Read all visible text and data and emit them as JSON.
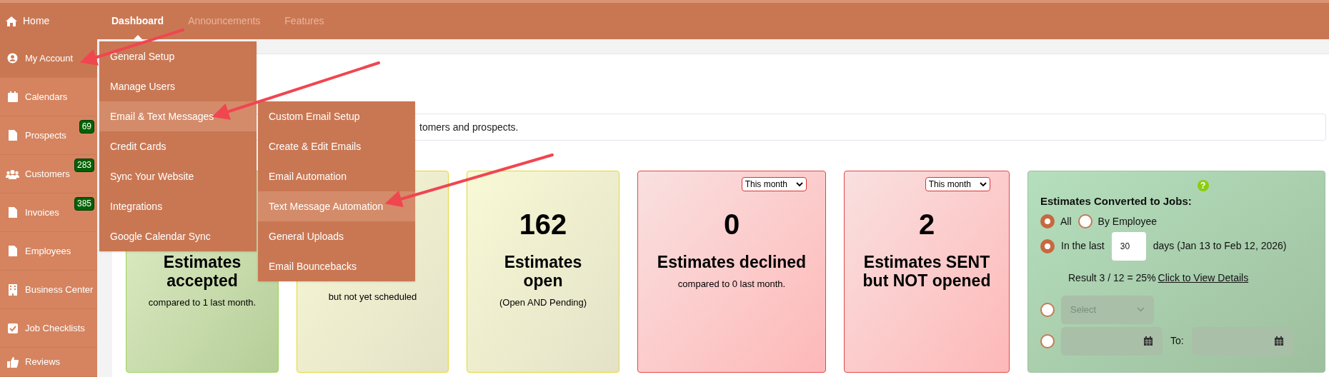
{
  "home_link": {
    "label": "Home"
  },
  "tabs": [
    {
      "label": "Dashboard",
      "selected": true
    },
    {
      "label": "Announcements",
      "selected": false
    },
    {
      "label": "Features",
      "selected": false
    }
  ],
  "sidebar": {
    "items": [
      {
        "label": "My Account",
        "selected": true
      },
      {
        "label": "Calendars",
        "selected": false
      },
      {
        "label": "Prospects",
        "selected": false,
        "badge": "69"
      },
      {
        "label": "Customers",
        "selected": false,
        "badge": "283"
      },
      {
        "label": "Invoices",
        "selected": false,
        "badge": "385"
      },
      {
        "label": "Employees",
        "selected": false
      },
      {
        "label": "Business Center",
        "selected": false
      },
      {
        "label": "Job Checklists",
        "selected": false
      },
      {
        "label": "Reviews",
        "selected": false
      }
    ]
  },
  "info_box": {
    "text": "tomers and prospects."
  },
  "cards": [
    {
      "color": "#9cd45a",
      "title_lines": [
        "Estimates",
        "accepted"
      ],
      "subtitle": "compared to 1 last month."
    },
    {
      "color": "#e5d63a",
      "subtitle": "but not yet scheduled"
    },
    {
      "color": "#e5d63b",
      "count": "162",
      "title_lines": [
        "Estimates",
        "open"
      ],
      "subtitle": "(Open AND Pending)"
    },
    {
      "color": "#e04848",
      "period": "This month",
      "count": "0",
      "title_lines": [
        "Estimates declined"
      ],
      "subtitle": "compared to 0 last month."
    },
    {
      "color": "#e04849",
      "period": "This month",
      "count": "2",
      "title_lines": [
        "Estimates SENT",
        "but NOT opened"
      ]
    }
  ],
  "conversion_panel": {
    "title": "Estimates Converted to Jobs:",
    "help": "?",
    "scope_options": [
      {
        "label": "All",
        "selected": true
      },
      {
        "label": "By Employee",
        "selected": false
      }
    ],
    "range_options": [
      {
        "kind": "last_days",
        "selected": true,
        "label": "In the last",
        "value": "30",
        "suffix": "days (Jan 13 to Feb 12, 2026)"
      },
      {
        "kind": "select",
        "selected": false,
        "placeholder": "Select"
      },
      {
        "kind": "date_range",
        "selected": false,
        "to_label": "To:"
      }
    ],
    "result": "Result 3 / 12 = 25%",
    "link": "Click to View Details"
  },
  "account_menu": {
    "items": [
      {
        "label": "General Setup",
        "highlighted": false
      },
      {
        "label": "Manage Users",
        "highlighted": false
      },
      {
        "label": "Email & Text Messages",
        "highlighted": true
      },
      {
        "label": "Credit Cards",
        "highlighted": false
      },
      {
        "label": "Sync Your Website",
        "highlighted": false
      },
      {
        "label": "Integrations",
        "highlighted": false
      },
      {
        "label": "Google Calendar Sync",
        "highlighted": false
      }
    ]
  },
  "messages_submenu": {
    "items": [
      {
        "label": "Custom Email Setup",
        "highlighted": false
      },
      {
        "label": "Create & Edit Emails",
        "highlighted": false
      },
      {
        "label": "Email Automation",
        "highlighted": false
      },
      {
        "label": "Text Message Automation",
        "highlighted": true
      },
      {
        "label": "General Uploads",
        "highlighted": false
      },
      {
        "label": "Email Bouncebacks",
        "highlighted": false
      }
    ]
  }
}
